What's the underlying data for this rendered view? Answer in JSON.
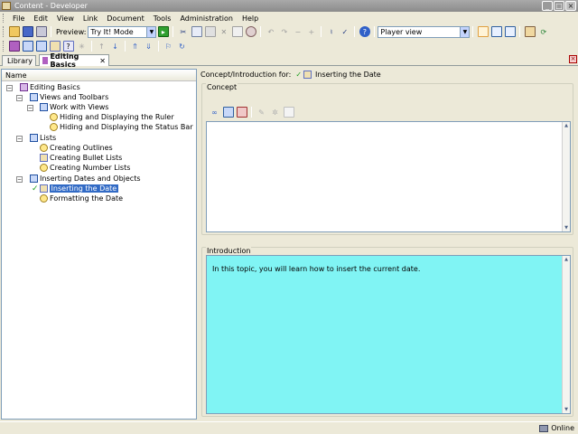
{
  "window": {
    "title": "Content - Developer"
  },
  "menu": {
    "items": [
      "File",
      "Edit",
      "View",
      "Link",
      "Document",
      "Tools",
      "Administration",
      "Help"
    ]
  },
  "toolbar": {
    "preview_label": "Preview:",
    "preview_mode": "Try It! Mode",
    "view_mode": "Player view"
  },
  "tabs": [
    {
      "label": "Library"
    },
    {
      "label": "Editing Basics"
    }
  ],
  "tree": {
    "column_header": "Name",
    "nodes": [
      {
        "label": "Editing Basics",
        "icon": "outline-icon"
      },
      {
        "label": "Views and Toolbars",
        "icon": "module-icon"
      },
      {
        "label": "Work with Views",
        "icon": "section-icon"
      },
      {
        "label": "Hiding and Displaying the Ruler",
        "icon": "topic-icon"
      },
      {
        "label": "Hiding and Displaying the Status Bar",
        "icon": "topic-icon"
      },
      {
        "label": "Lists",
        "icon": "module-icon"
      },
      {
        "label": "Creating Outlines",
        "icon": "topic-icon"
      },
      {
        "label": "Creating Bullet Lists",
        "icon": "topic-icon"
      },
      {
        "label": "Creating Number Lists",
        "icon": "topic-icon"
      },
      {
        "label": "Inserting Dates and Objects",
        "icon": "module-icon"
      },
      {
        "label": "Inserting the Date",
        "icon": "topic-icon",
        "selected": true
      },
      {
        "label": "Formatting the Date",
        "icon": "topic-icon"
      }
    ]
  },
  "editor": {
    "header_prefix": "Concept/Introduction for:",
    "header_topic": "Inserting the Date",
    "concept_label": "Concept",
    "introduction_label": "Introduction",
    "introduction_text": "In this topic, you will learn how to insert the current date."
  },
  "status": {
    "connection": "Online"
  },
  "colors": {
    "selection": "#316ac5",
    "intro_background": "#80f4f4",
    "titlebar": "#8b8b8b"
  }
}
